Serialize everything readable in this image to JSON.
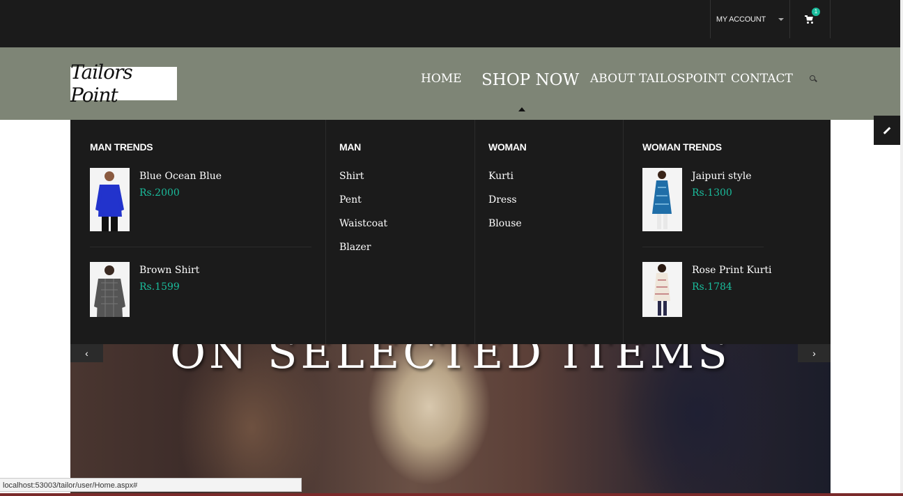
{
  "topbar": {
    "account_label": "MY ACCOUNT",
    "cart_count": "1"
  },
  "logo_text": "Tailors Point",
  "nav": {
    "home": "HOME",
    "shop": "SHOP NOW",
    "about": "ABOUT TAILOSPOINT",
    "contact": "CONTACT"
  },
  "mega": {
    "man_trends": {
      "title": "MAN TRENDS",
      "products": [
        {
          "name": "Blue Ocean Blue",
          "price": "Rs.2000"
        },
        {
          "name": "Brown Shirt",
          "price": "Rs.1599"
        }
      ]
    },
    "man": {
      "title": "MAN",
      "links": [
        "Shirt",
        "Pent",
        "Waistcoat",
        "Blazer"
      ]
    },
    "woman": {
      "title": "WOMAN",
      "links": [
        "Kurti",
        "Dress",
        "Blouse"
      ]
    },
    "woman_trends": {
      "title": "WOMAN TRENDS",
      "products": [
        {
          "name": "Jaipuri style",
          "price": "Rs.1300"
        },
        {
          "name": "Rose Print Kurti",
          "price": "Rs.1784"
        }
      ]
    }
  },
  "hero_text": "ON SELECTED ITEMS",
  "status_url": "localhost:53003/tailor/user/Home.aspx#",
  "colors": {
    "accent": "#1abc9c",
    "header_bg": "#7e8576",
    "menu_bg": "#1b1b1b"
  }
}
